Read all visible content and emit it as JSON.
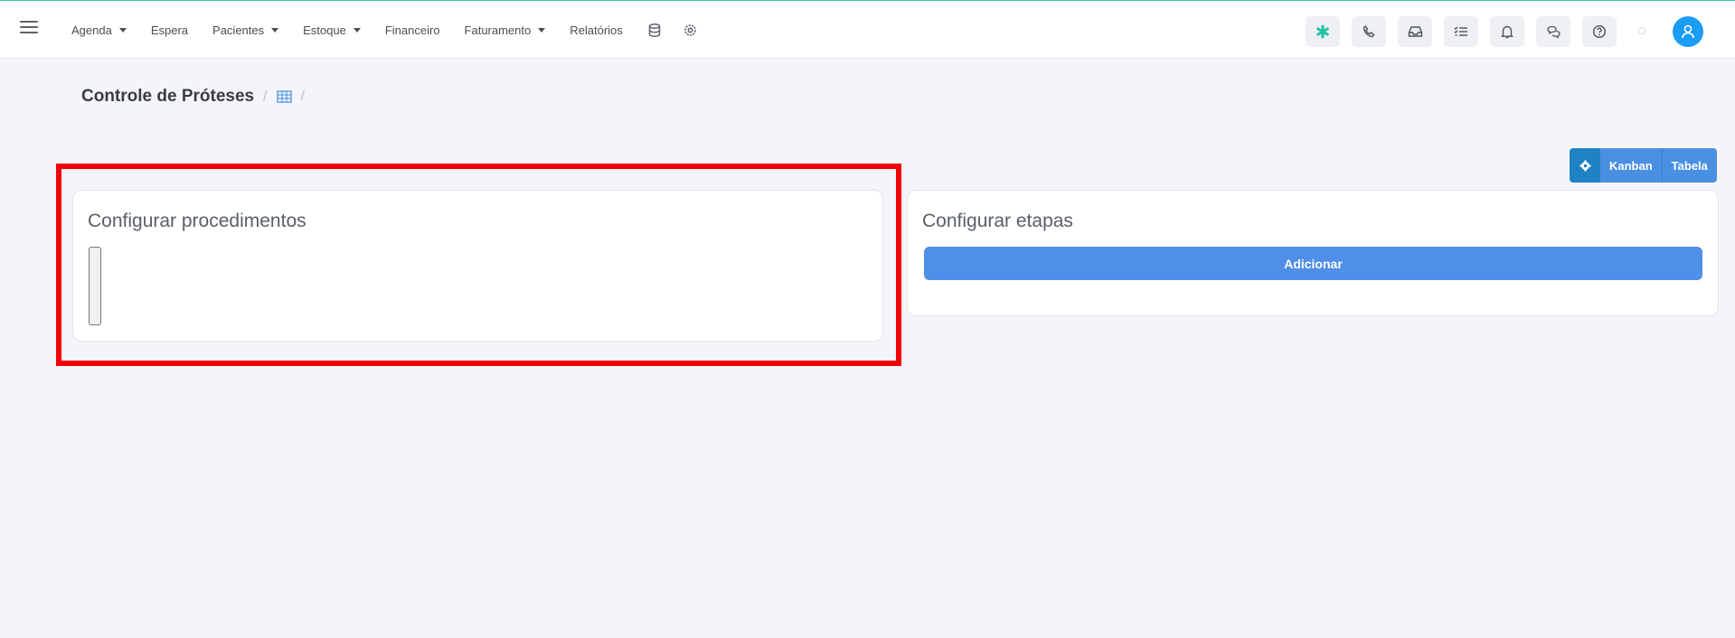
{
  "nav": {
    "menu": [
      {
        "label": "Agenda",
        "dropdown": true
      },
      {
        "label": "Espera",
        "dropdown": false
      },
      {
        "label": "Pacientes",
        "dropdown": true
      },
      {
        "label": "Estoque",
        "dropdown": true
      },
      {
        "label": "Financeiro",
        "dropdown": false
      },
      {
        "label": "Faturamento",
        "dropdown": true
      },
      {
        "label": "Relatórios",
        "dropdown": false
      }
    ],
    "extra_icons": [
      "database-icon",
      "settings-icon"
    ],
    "right_icons": [
      "asterisk-icon",
      "phone-icon",
      "inbox-icon",
      "task-list-icon",
      "bell-icon",
      "chat-icon",
      "help-icon"
    ],
    "accent_color": "#35c4b5",
    "avatar_color": "#1b9cf5"
  },
  "breadcrumb": {
    "title": "Controle de Próteses",
    "separator": "/",
    "icon": "grid-icon"
  },
  "view_switch": {
    "options": [
      "Kanban",
      "Tabela"
    ],
    "settings_icon": "gear-icon"
  },
  "procedures_card": {
    "title": "Configurar procedimentos"
  },
  "stages_card": {
    "title": "Configurar etapas",
    "add_label": "Adicionar",
    "button_color": "#4f8ee9"
  },
  "highlight_color": "#f2000a"
}
